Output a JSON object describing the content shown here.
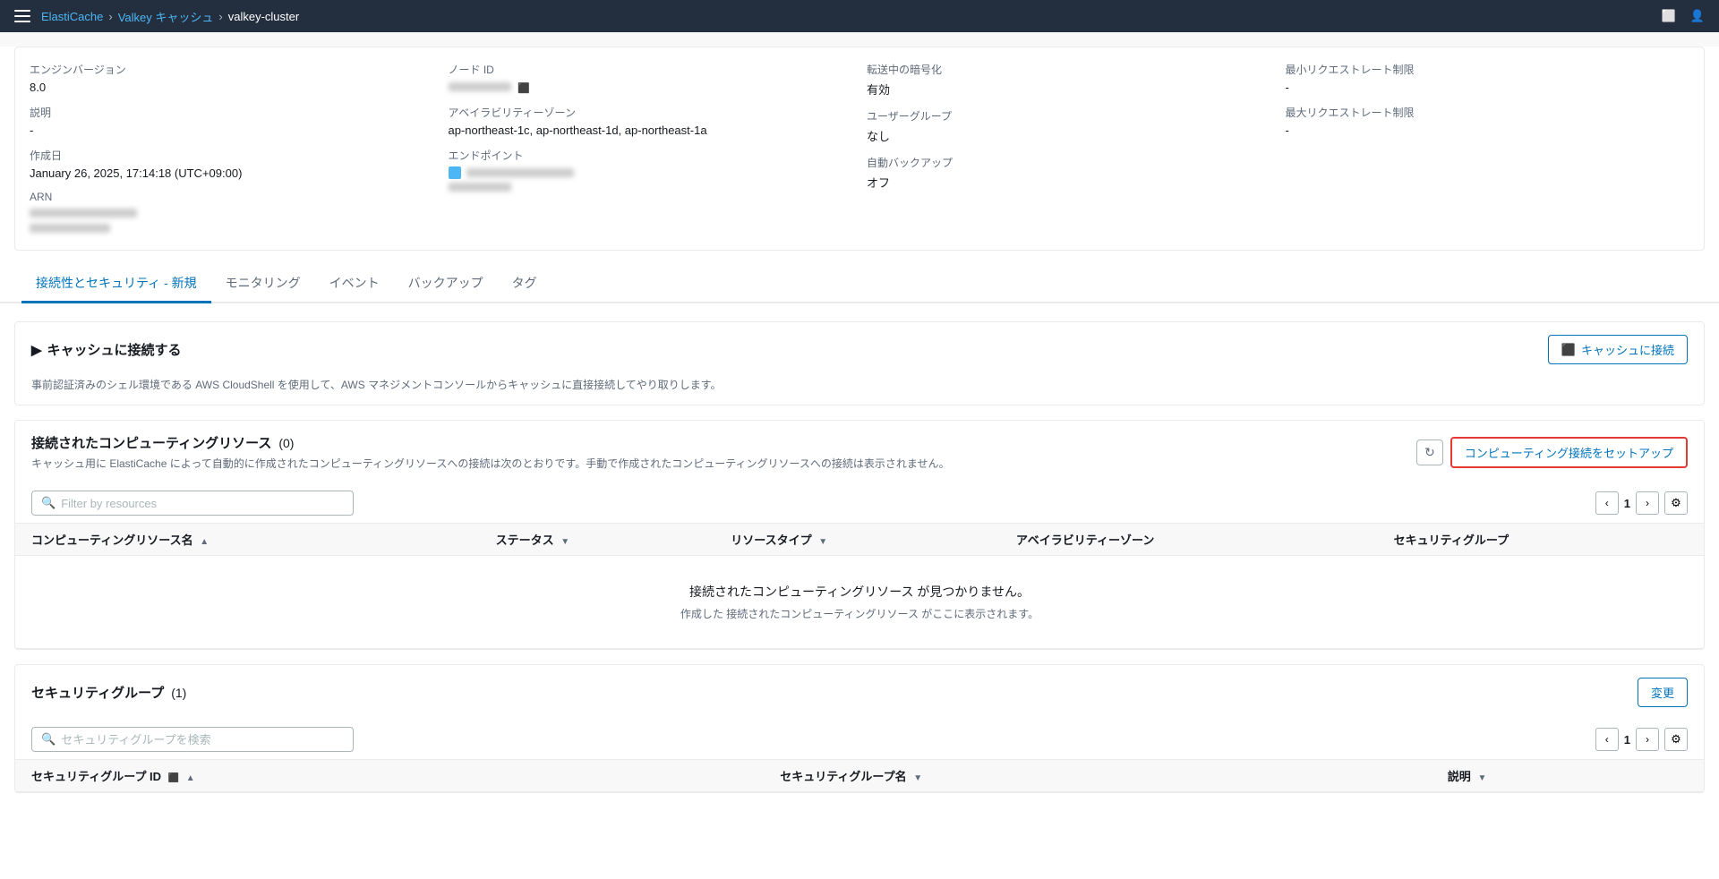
{
  "topbar": {
    "menu_icon": "☰",
    "breadcrumb": [
      {
        "label": "ElastiCache",
        "href": "#",
        "type": "link"
      },
      {
        "label": "Valkey キャッシュ",
        "href": "#",
        "type": "link"
      },
      {
        "label": "valkey-cluster",
        "type": "current"
      }
    ],
    "icon_monitor": "⬜",
    "icon_user": "⬚"
  },
  "info_card": {
    "cols": [
      {
        "rows": [
          {
            "label": "エンジンバージョン",
            "value": "8.0"
          },
          {
            "label": "説明",
            "value": "-"
          },
          {
            "label": "作成日",
            "value": "January 26, 2025, 17:14:18 (UTC+09:00)"
          },
          {
            "label": "ARN",
            "value": "[blurred]"
          }
        ]
      },
      {
        "rows": [
          {
            "label": "ノード ID",
            "value": "[blurred-link]"
          },
          {
            "label": "アベイラビリティーゾーン",
            "value": "ap-northeast-1c, ap-northeast-1d, ap-northeast-1a"
          },
          {
            "label": "エンドポイント",
            "value": "[blurred]"
          }
        ]
      },
      {
        "rows": [
          {
            "label": "転送中の暗号化",
            "value": "有効"
          },
          {
            "label": "ユーザーグループ",
            "value": "なし"
          },
          {
            "label": "自動バックアップ",
            "value": "オフ"
          }
        ]
      },
      {
        "rows": [
          {
            "label": "最小リクエストレート制限",
            "value": "-"
          },
          {
            "label": "最大リクエストレート制限",
            "value": "-"
          }
        ]
      }
    ]
  },
  "tabs": [
    {
      "id": "connectivity",
      "label": "接続性とセキュリティ - 新規",
      "active": true
    },
    {
      "id": "monitoring",
      "label": "モニタリング",
      "active": false
    },
    {
      "id": "events",
      "label": "イベント",
      "active": false
    },
    {
      "id": "backup",
      "label": "バックアップ",
      "active": false
    },
    {
      "id": "tags",
      "label": "タグ",
      "active": false
    }
  ],
  "connect_section": {
    "title": "キャッシュに接続する",
    "description": "事前認証済みのシェル環境である AWS CloudShell を使用して、AWS マネジメントコンソールからキャッシュに直接接続してやり取りします。",
    "button_label": "キャッシュに接続",
    "button_icon": "⬛"
  },
  "computing_section": {
    "title": "接続されたコンピューティングリソース",
    "count": "(0)",
    "description": "キャッシュ用に ElastiCache によって自動的に作成されたコンピューティングリソースへの接続は次のとおりです。手動で作成されたコンピューティングリソースへの接続は表示されません。",
    "setup_button_label": "コンピューティング接続をセットアップ",
    "refresh_icon": "↻",
    "search_placeholder": "Filter by resources",
    "pagination": {
      "prev": "‹",
      "page": "1",
      "next": "›"
    },
    "table": {
      "columns": [
        {
          "label": "コンピューティングリソース名",
          "sortable": true,
          "sort_icon": "▲"
        },
        {
          "label": "ステータス",
          "sortable": true,
          "sort_icon": "▼"
        },
        {
          "label": "リソースタイプ",
          "sortable": true,
          "sort_icon": "▼"
        },
        {
          "label": "アベイラビリティーゾーン",
          "sortable": false
        },
        {
          "label": "セキュリティグループ",
          "sortable": false
        }
      ],
      "empty": {
        "main": "接続されたコンピューティングリソース が見つかりません。",
        "sub": "作成した 接続されたコンピューティングリソース がここに表示されます。"
      }
    }
  },
  "security_section": {
    "title": "セキュリティグループ",
    "count": "(1)",
    "edit_button_label": "変更",
    "search_placeholder": "セキュリティグループを検索",
    "pagination": {
      "prev": "‹",
      "page": "1",
      "next": "›"
    },
    "table": {
      "columns": [
        {
          "label": "セキュリティグループ ID",
          "sortable": true,
          "sort_icon": "▲"
        },
        {
          "label": "セキュリティグループ名",
          "sortable": true,
          "sort_icon": "▼"
        },
        {
          "label": "説明",
          "sortable": true,
          "sort_icon": "▼"
        }
      ]
    }
  }
}
